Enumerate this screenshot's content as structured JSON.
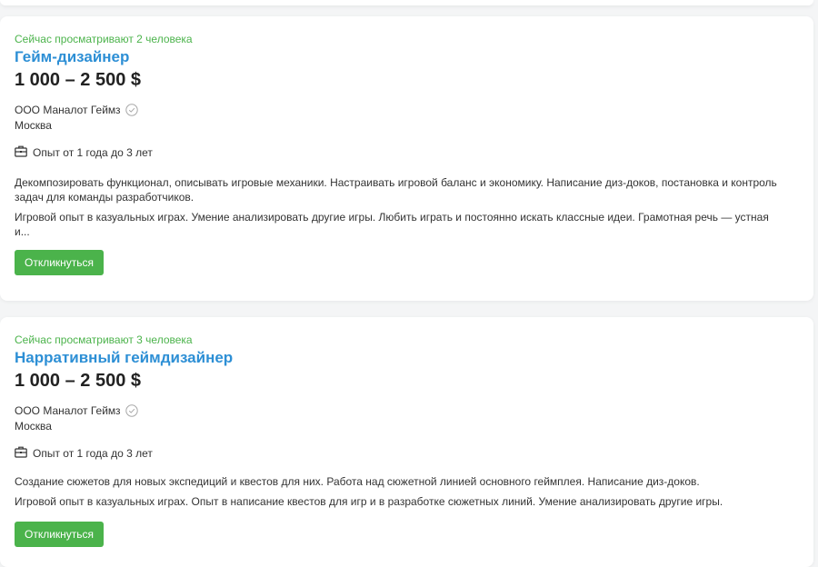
{
  "vacancies": [
    {
      "viewers": "Сейчас просматривают 2 человека",
      "title": "Гейм-дизайнер",
      "salary": "1 000 – 2 500 $",
      "company": "ООО Маналот Геймз",
      "city": "Москва",
      "experience": "Опыт от 1 года до 3 лет",
      "description": "Декомпозировать функционал, описывать игровые механики. Настраивать игровой баланс и экономику. Написание диз-доков, постановка и контроль задач для команды разработчиков.",
      "requirements": "Игровой опыт в казуальных играх. Умение анализировать другие игры. Любить играть и постоянно искать классные идеи. Грамотная речь — устная и...",
      "apply_label": "Откликнуться"
    },
    {
      "viewers": "Сейчас просматривают 3 человека",
      "title": "Нарративный геймдизайнер",
      "salary": "1 000 – 2 500 $",
      "company": "ООО Маналот Геймз",
      "city": "Москва",
      "experience": "Опыт от 1 года до 3 лет",
      "description": "Создание сюжетов для новых экспедиций и квестов для них. Работа над сюжетной линией основного геймплея. Написание диз-доков.",
      "requirements": "Игровой опыт в казуальных играх. Опыт в написание квестов для игр и в разработке сюжетных линий. Умение анализировать другие игры.",
      "apply_label": "Откликнуться"
    }
  ],
  "colors": {
    "accent_green": "#4bb34b",
    "link_blue": "#2d8fd5",
    "background": "#f4f5f6"
  },
  "icons": {
    "verified": "check-circle-icon",
    "experience": "briefcase-icon"
  }
}
